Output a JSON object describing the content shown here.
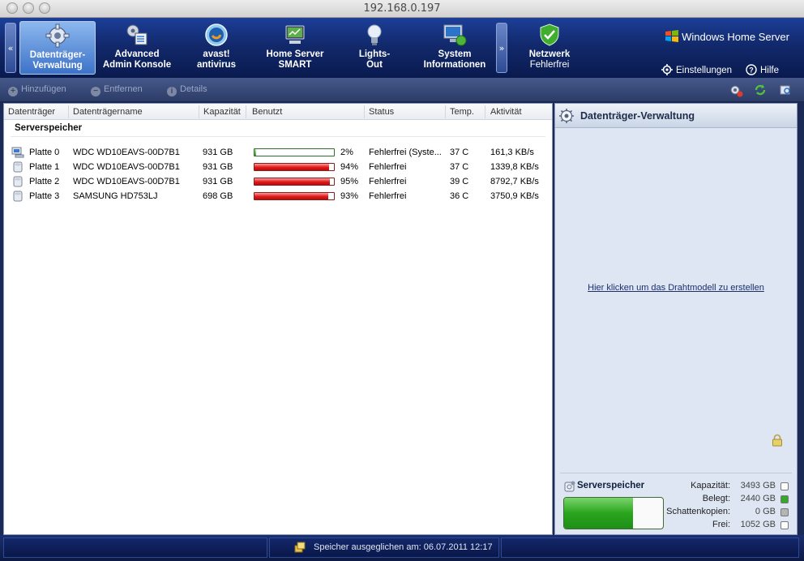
{
  "window": {
    "title": "192.168.0.197"
  },
  "nav": {
    "items": [
      {
        "line1": "Datenträger-",
        "line2": "Verwaltung",
        "icon": "gear-icon",
        "active": true
      },
      {
        "line1": "Advanced",
        "line2": "Admin Konsole",
        "icon": "admin-console-icon"
      },
      {
        "line1": "avast!",
        "line2": "antivirus",
        "icon": "avast-icon"
      },
      {
        "line1": "Home Server",
        "line2": "SMART",
        "icon": "disk-smart-icon"
      },
      {
        "line1": "Lights-",
        "line2": "Out",
        "icon": "lightbulb-icon"
      },
      {
        "line1": "System",
        "line2": "Informationen",
        "icon": "system-info-icon"
      },
      {
        "line1": "Netzwerk",
        "line2": "Fehlerfrei",
        "icon": "shield-check-icon"
      }
    ],
    "left_arrow": "«",
    "right_arrow": "»",
    "brand": "Windows Home Server",
    "settings": "Einstellungen",
    "help": "Hilfe"
  },
  "toolbar": {
    "add": "Hinzufügen",
    "remove": "Entfernen",
    "details": "Details"
  },
  "table": {
    "columns": [
      "Datenträger",
      "Datenträgername",
      "Kapazität",
      "Benutzt",
      "Status",
      "Temp.",
      "Aktivität"
    ],
    "group": "Serverspeicher",
    "rows": [
      {
        "disk": "Platte 0",
        "name": "WDC WD10EAVS-00D7B1",
        "capacity": "931 GB",
        "used_pct": 2,
        "used": "2%",
        "status": "Fehlerfrei (Syste...",
        "temp": "37 C",
        "activity": "161,3 KB/s",
        "bar": "green",
        "icon": "system-disk-icon"
      },
      {
        "disk": "Platte 1",
        "name": "WDC WD10EAVS-00D7B1",
        "capacity": "931 GB",
        "used_pct": 94,
        "used": "94%",
        "status": "Fehlerfrei",
        "temp": "37 C",
        "activity": "1339,8 KB/s",
        "bar": "red",
        "icon": "disk-icon"
      },
      {
        "disk": "Platte 2",
        "name": "WDC WD10EAVS-00D7B1",
        "capacity": "931 GB",
        "used_pct": 95,
        "used": "95%",
        "status": "Fehlerfrei",
        "temp": "39 C",
        "activity": "8792,7 KB/s",
        "bar": "red",
        "icon": "disk-icon"
      },
      {
        "disk": "Platte 3",
        "name": "SAMSUNG HD753LJ",
        "capacity": "698 GB",
        "used_pct": 93,
        "used": "93%",
        "status": "Fehlerfrei",
        "temp": "36 C",
        "activity": "3750,9 KB/s",
        "bar": "red",
        "icon": "disk-icon"
      }
    ]
  },
  "panel": {
    "title": "Datenträger-Verwaltung",
    "link": "Hier klicken um das Drahtmodell zu erstellen",
    "storage": {
      "title": "Serverspeicher",
      "used_fraction": 0.7,
      "stats": [
        {
          "label": "Kapazität:",
          "value": "3493 GB",
          "color": "#ffffff"
        },
        {
          "label": "Belegt:",
          "value": "2440 GB",
          "color": "#3aa62e"
        },
        {
          "label": "Schattenkopien:",
          "value": "0 GB",
          "color": "#b5b5b5"
        },
        {
          "label": "Frei:",
          "value": "1052 GB",
          "color": "#ffffff"
        }
      ]
    }
  },
  "status": {
    "text": "Speicher ausgeglichen am: 06.07.2011 12:17"
  }
}
